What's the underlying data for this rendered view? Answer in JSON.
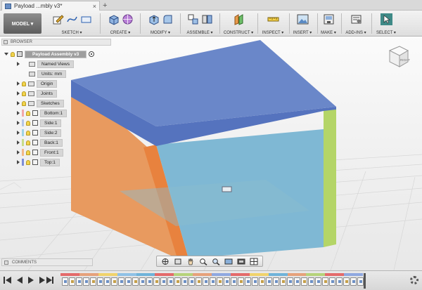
{
  "window": {
    "doc_title": "Payload ...mbly v3*",
    "close_glyph": "×",
    "new_tab_glyph": "+"
  },
  "toolbar": {
    "workspace": "MODEL ▾",
    "groups": [
      {
        "id": "sketch",
        "label": "SKETCH ▾"
      },
      {
        "id": "create",
        "label": "CREATE ▾"
      },
      {
        "id": "modify",
        "label": "MODIFY ▾"
      },
      {
        "id": "assemble",
        "label": "ASSEMBLE ▾"
      },
      {
        "id": "construct",
        "label": "CONSTRUCT ▾"
      },
      {
        "id": "inspect",
        "label": "INSPECT ▾"
      },
      {
        "id": "insert",
        "label": "INSERT ▾"
      },
      {
        "id": "make",
        "label": "MAKE ▾"
      },
      {
        "id": "addins",
        "label": "ADD-INS ▾"
      },
      {
        "id": "select",
        "label": "SELECT ▾"
      }
    ]
  },
  "browser": {
    "title": "BROWSER",
    "root": "Payload Assembly v3",
    "items": [
      {
        "label": "Named Views",
        "kind": "folder"
      },
      {
        "label": "Units: mm",
        "kind": "units"
      },
      {
        "label": "Origin",
        "kind": "folder"
      },
      {
        "label": "Joints",
        "kind": "folder"
      },
      {
        "label": "Sketches",
        "kind": "folder"
      },
      {
        "label": "Bottom:1",
        "kind": "component",
        "color": "#f2a9a9"
      },
      {
        "label": "Side:1",
        "kind": "component",
        "color": "#b5c6e8"
      },
      {
        "label": "Side:2",
        "kind": "component",
        "color": "#9fd3e6"
      },
      {
        "label": "Back:1",
        "kind": "component",
        "color": "#c9dc8a"
      },
      {
        "label": "Front:1",
        "kind": "component",
        "color": "#f1b98a"
      },
      {
        "label": "Top:1",
        "kind": "component",
        "color": "#7d8ed6"
      }
    ]
  },
  "viewcube": {
    "face": "RIGHT"
  },
  "comments": {
    "title": "COMMENTS"
  },
  "navbar": {
    "icons": [
      "orbit-icon",
      "look-at-icon",
      "pan-icon",
      "zoom-icon",
      "fit-icon",
      "display-settings-icon",
      "visual-style-icon",
      "grid-icon"
    ]
  },
  "timeline": {
    "controls": [
      "first",
      "previous",
      "play",
      "next",
      "last"
    ],
    "item_count": 43,
    "strip_colors": [
      "#e46a6a",
      "#e6a17a",
      "#f1d36b",
      "#8fc1e6",
      "#6fb3d9",
      "#e46a6a",
      "#b6d37a",
      "#e6a17a",
      "#8fa8e0",
      "#e46a6a",
      "#f1d36b",
      "#6fb3d9",
      "#e6a17a",
      "#b6d37a",
      "#e46a6a",
      "#8fa8e0"
    ]
  },
  "colors": {
    "top": "#6a87c9",
    "top_side": "#5777c1",
    "front_face": "#7ab5d3",
    "left_panel": "#de9a6a",
    "left_panel_dark": "#e8894c",
    "back_edge": "#b6d56b",
    "grid": "#d7d7d7"
  }
}
